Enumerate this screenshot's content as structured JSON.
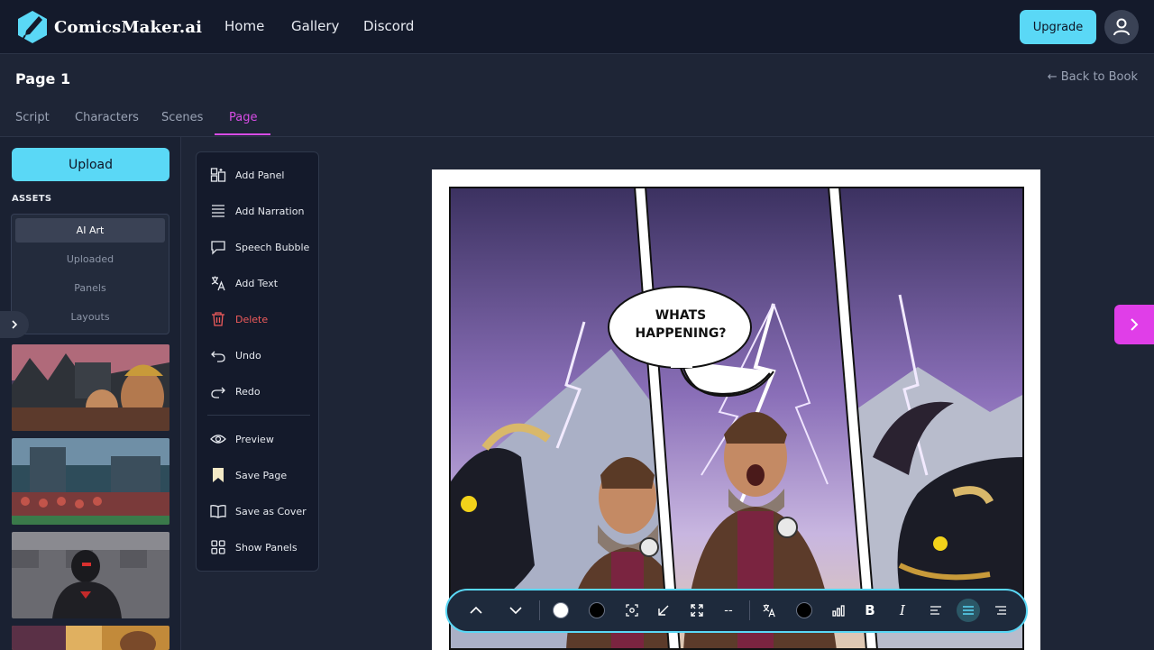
{
  "nav": {
    "brand": "ComicsMaker.ai",
    "links": [
      "Home",
      "Gallery",
      "Discord"
    ],
    "upgrade_label": "Upgrade"
  },
  "header": {
    "page_title": "Page 1",
    "back_link": "← Back to Book",
    "tabs": [
      "Script",
      "Characters",
      "Scenes",
      "Page"
    ],
    "active_tab": "Page"
  },
  "sidebar": {
    "upload_label": "Upload",
    "assets_label": "ASSETS",
    "asset_tabs": [
      "AI Art",
      "Uploaded",
      "Panels",
      "Layouts"
    ],
    "active_asset_tab": "AI Art"
  },
  "tools": [
    {
      "label": "Add Panel",
      "icon": "add-panel-icon"
    },
    {
      "label": "Add Narration",
      "icon": "narration-icon"
    },
    {
      "label": "Speech Bubble",
      "icon": "speech-bubble-icon"
    },
    {
      "label": "Add Text",
      "icon": "translate-text-icon"
    },
    {
      "label": "Delete",
      "icon": "trash-icon"
    },
    {
      "label": "Undo",
      "icon": "undo-icon"
    },
    {
      "label": "Redo",
      "icon": "redo-icon"
    },
    {
      "label": "Preview",
      "icon": "eye-icon"
    },
    {
      "label": "Save Page",
      "icon": "bookmark-icon"
    },
    {
      "label": "Save as Cover",
      "icon": "open-book-icon"
    },
    {
      "label": "Show Panels",
      "icon": "grid-icon"
    }
  ],
  "canvas": {
    "bubble_line1": "WHATS",
    "bubble_line2": "HAPPENING?"
  },
  "bottombar": {
    "dash_label": "--",
    "bold_label": "B",
    "italic_label": "I",
    "active_alignment": "center"
  },
  "colors": {
    "accent_cyan": "#5ad8f6",
    "accent_magenta": "#d74ce5",
    "delete_red": "#ef5b5b",
    "background": "#1e2536"
  }
}
